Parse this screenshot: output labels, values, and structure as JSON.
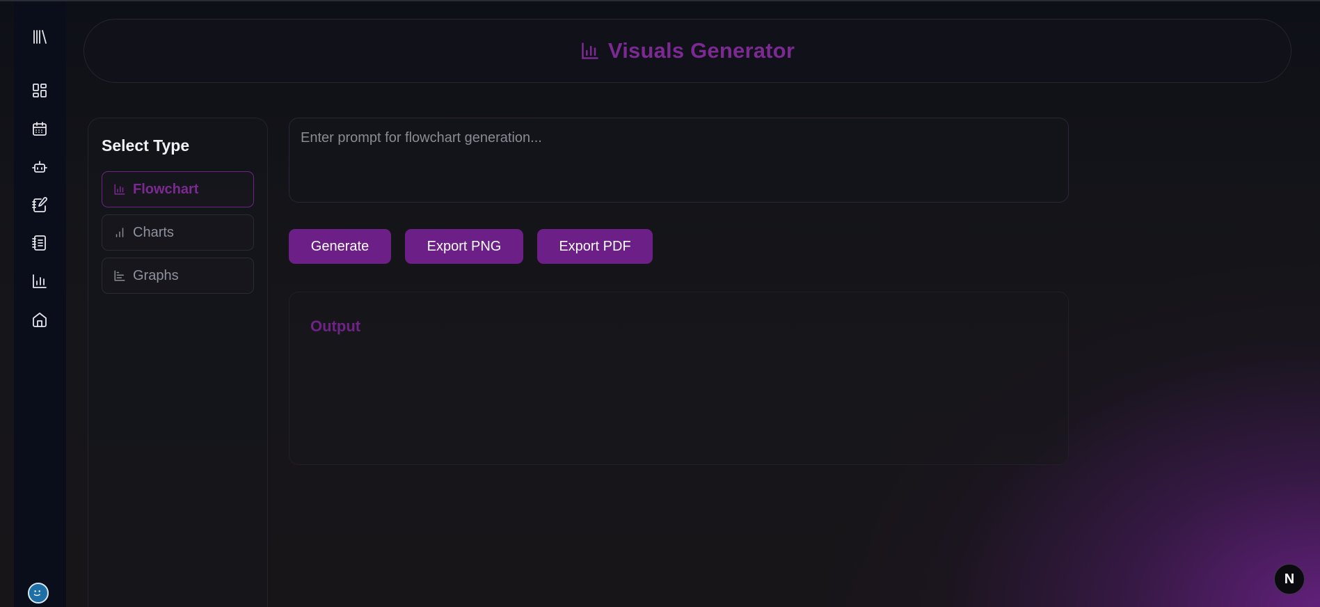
{
  "app": {
    "title": "Visuals Generator",
    "accent_color": "#7b2a91"
  },
  "sidebar": {
    "logo_icon": "library-icon",
    "items": [
      {
        "icon": "dashboard-icon"
      },
      {
        "icon": "calendar-icon"
      },
      {
        "icon": "bot-icon"
      },
      {
        "icon": "notebook-pen-icon"
      },
      {
        "icon": "notebook-text-icon"
      },
      {
        "icon": "bar-chart-icon"
      },
      {
        "icon": "home-icon"
      }
    ],
    "avatar_icon": "user-avatar"
  },
  "select_type": {
    "title": "Select Type",
    "options": [
      {
        "label": "Flowchart",
        "icon": "bar-chart-icon",
        "active": true
      },
      {
        "label": "Charts",
        "icon": "signal-chart-icon",
        "active": false
      },
      {
        "label": "Graphs",
        "icon": "bar-chart-horizontal-icon",
        "active": false
      }
    ]
  },
  "prompt": {
    "placeholder": "Enter prompt for flowchart generation...",
    "value": ""
  },
  "actions": {
    "generate": "Generate",
    "export_png": "Export PNG",
    "export_pdf": "Export PDF"
  },
  "output": {
    "title": "Output"
  },
  "fab": {
    "label": "N"
  }
}
